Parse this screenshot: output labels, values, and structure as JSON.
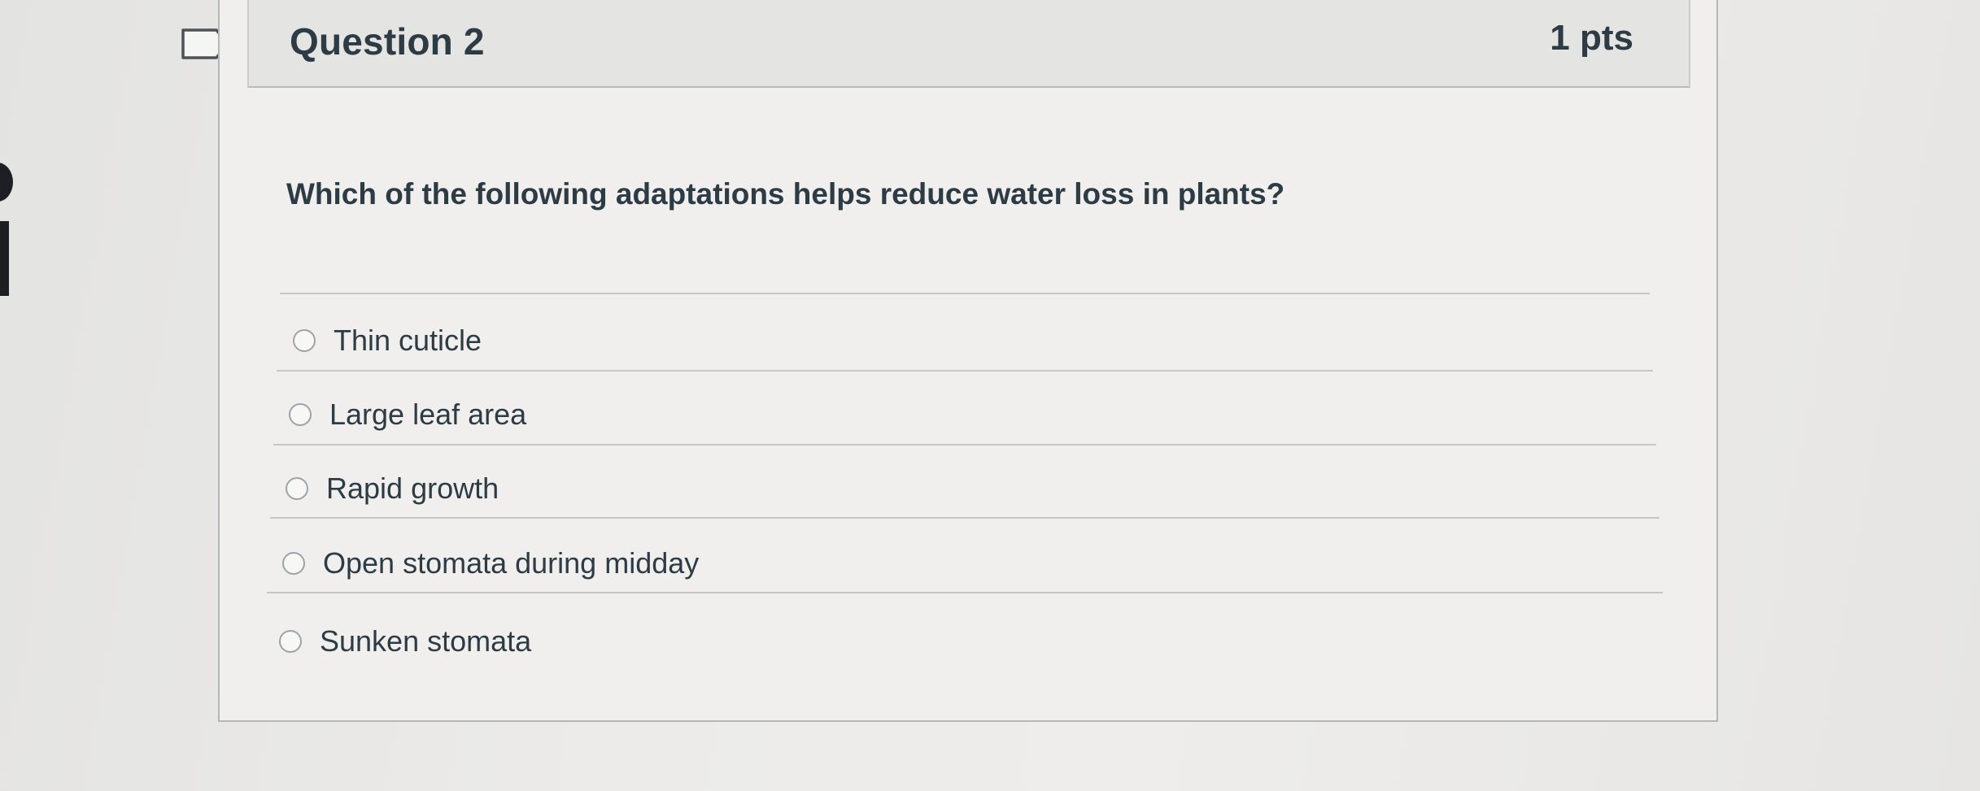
{
  "question": {
    "title": "Question 2",
    "points": "1 pts",
    "text": "Which of the following adaptations helps reduce water loss in plants?",
    "answers": [
      {
        "label": "Thin cuticle",
        "selected": false
      },
      {
        "label": "Large leaf area",
        "selected": false
      },
      {
        "label": "Rapid growth",
        "selected": false
      },
      {
        "label": "Open stomata during midday",
        "selected": false
      },
      {
        "label": "Sunken stomata",
        "selected": false
      }
    ]
  },
  "icons": {
    "flag": "flag-bookmark-icon",
    "radio": "radio-unchecked-icon"
  },
  "colors": {
    "text": "#2d3b45",
    "border": "#b4b7ba",
    "header_bg": "#e4e4e2"
  }
}
